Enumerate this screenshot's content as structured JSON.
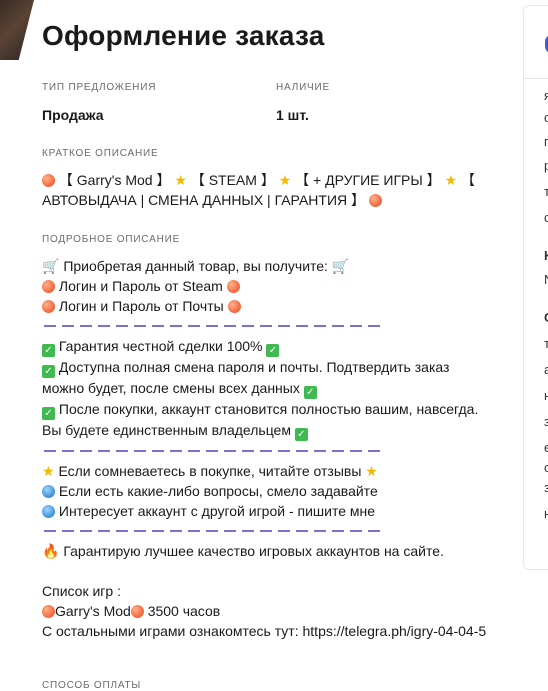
{
  "header": {
    "title": "Оформление заказа"
  },
  "offer": {
    "type_label": "ТИП ПРЕДЛОЖЕНИЯ",
    "type_value": "Продажа",
    "stock_label": "НАЛИЧИЕ",
    "stock_value": "1 шт."
  },
  "short_description": {
    "label": "КРАТКОЕ ОПИСАНИЕ",
    "parts": [
      "【 Garry's Mod 】",
      "【 STEAM 】",
      "【 + ДРУГИЕ ИГРЫ 】",
      "【 АВТОВЫДАЧА | СМЕНА ДАННЫХ | ГАРАНТИЯ 】"
    ]
  },
  "long_description": {
    "label": "ПОДРОБНОЕ ОПИСАНИЕ",
    "l1": "Приобретая данный товар, вы получите:",
    "l2": "Логин и Пароль от Steam",
    "l3": "Логин и Пароль от Почты",
    "l4": "Гарантия честной сделки 100%",
    "l5": "Доступна полная смена пароля и почты. Подтвердить заказ можно будет, после смены всех данных",
    "l6": "После покупки, аккаунт становится полностью вашим, навсегда. Вы будете единственным владельцем",
    "l7": "Если сомневаетесь в покупке, читайте отзывы",
    "l8": "Если есть какие-либо вопросы, смело задавайте",
    "l9": "Интересует аккаунт с другой игрой - пишите мне",
    "l10": "Гарантирую лучшее качество игровых аккаунтов на сайте.",
    "games_title": "Список игр :",
    "game_name": "Garry's Mod",
    "game_hours": "3500 часов",
    "others": "С остальными играми ознакомтесь тут: https://telegra.ph/igry-04-04-5"
  },
  "payment": {
    "label": "СПОСОБ ОПЛАТЫ"
  },
  "sidebar": {
    "letters": [
      "я",
      "с",
      "п",
      "р",
      "т",
      "с",
      "К",
      "N",
      "С",
      "т",
      "а",
      "н",
      "з",
      "е",
      "с",
      "з",
      "н"
    ]
  },
  "colors": {
    "separator": "#7b6fd6",
    "accent_logo": "#3c5bd8"
  }
}
